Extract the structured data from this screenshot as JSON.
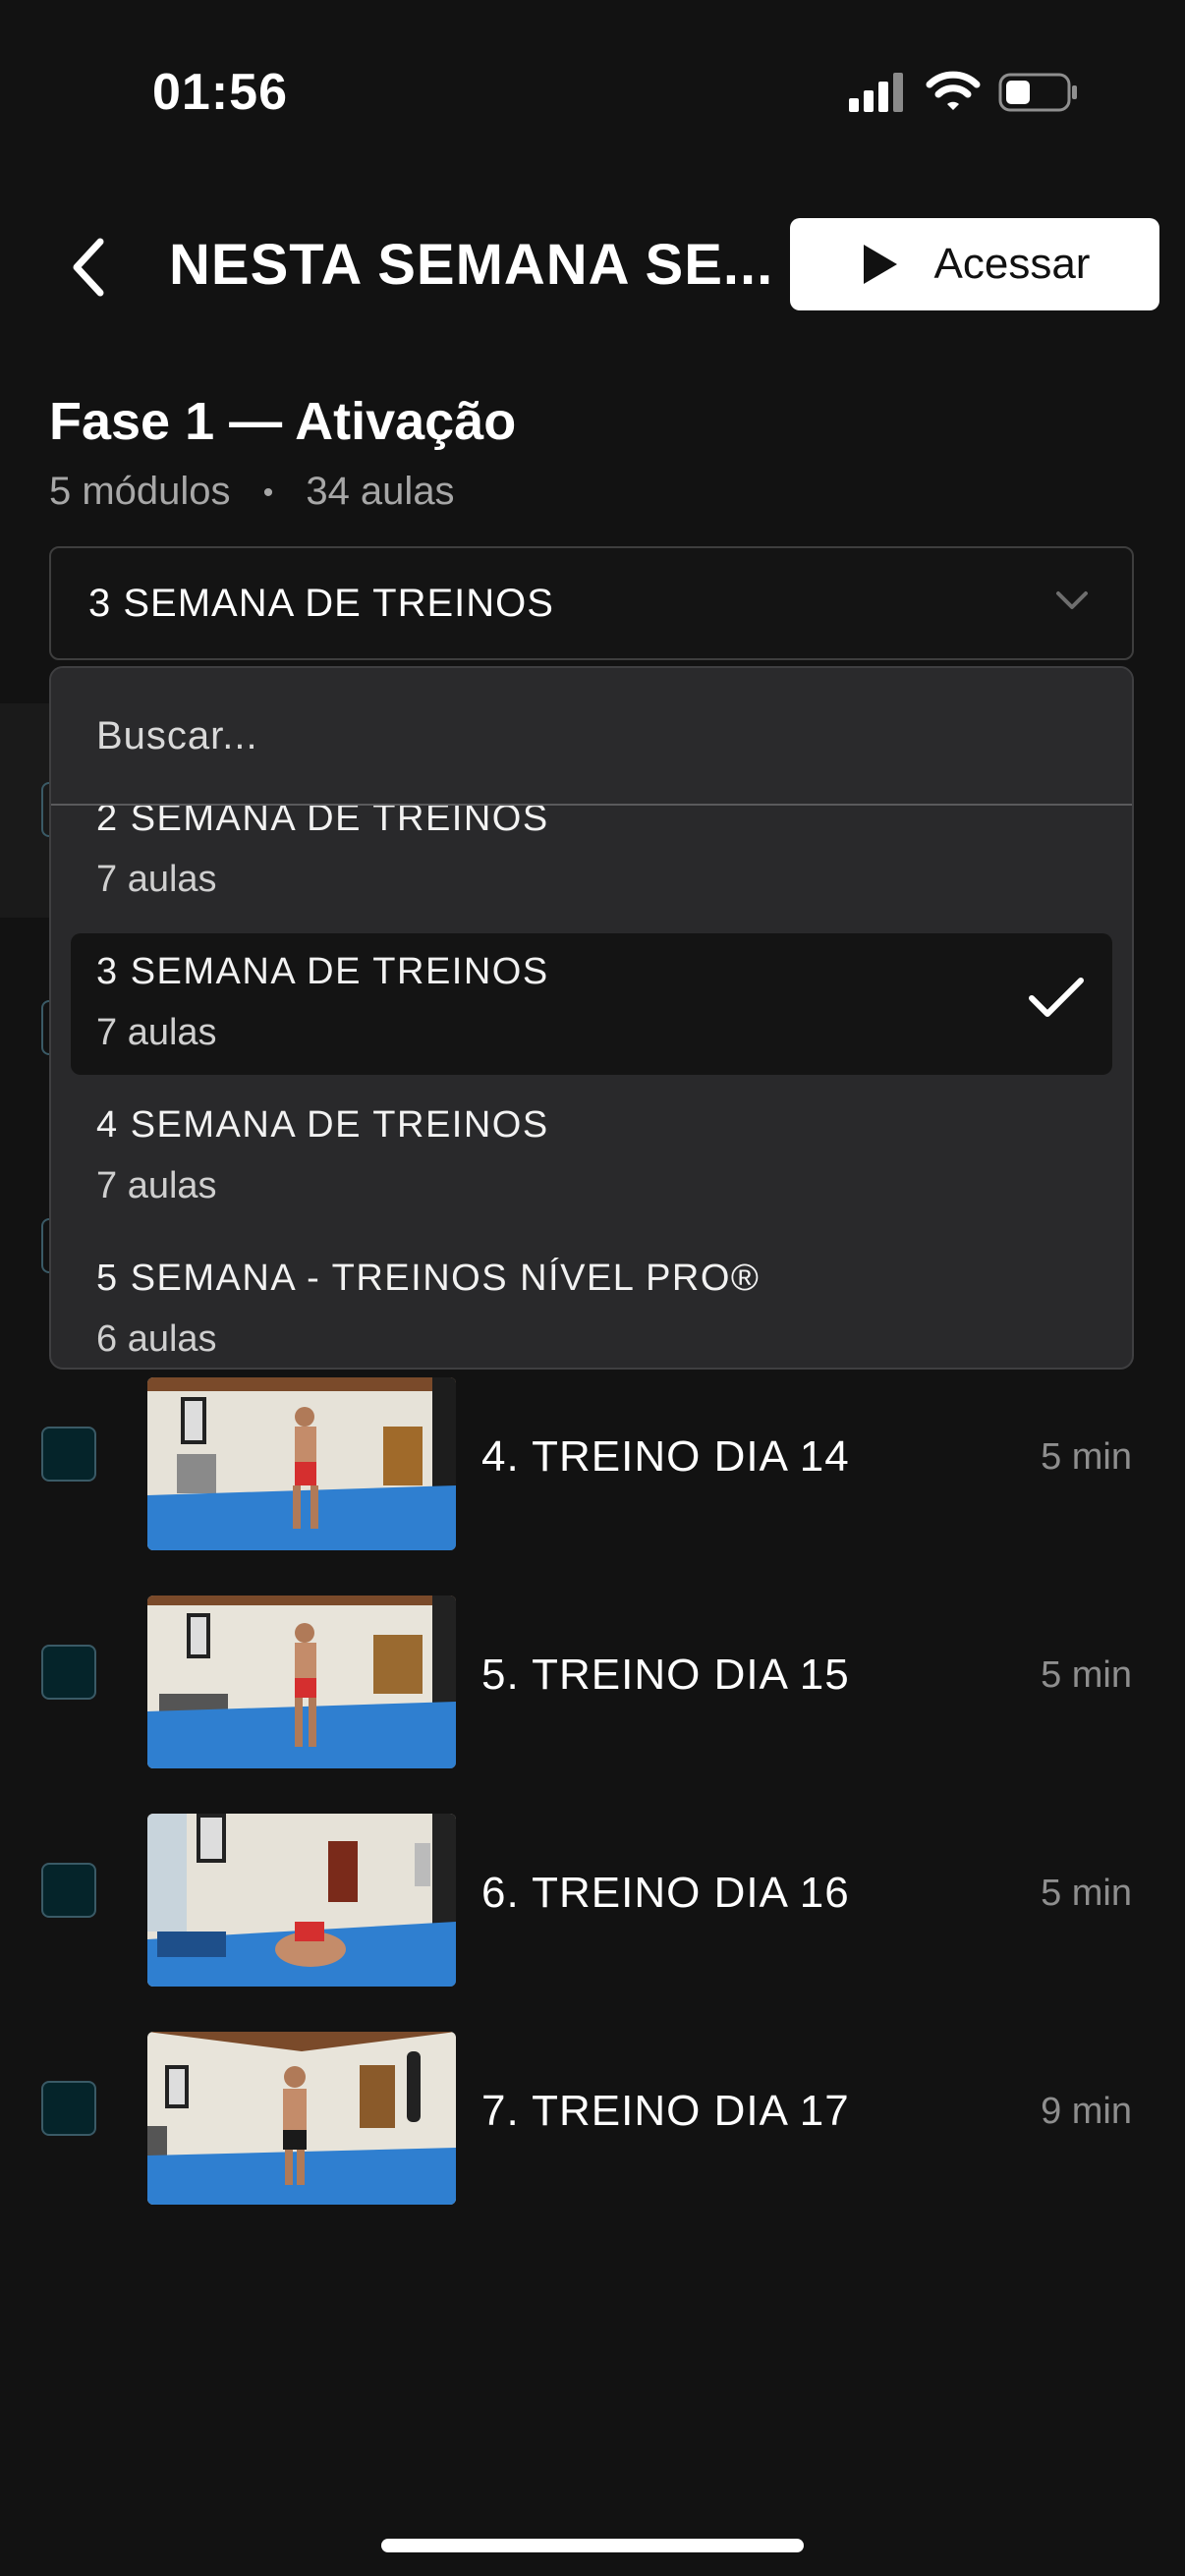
{
  "status_bar": {
    "time": "01:56"
  },
  "header": {
    "title": "NESTA SEMANA SE...",
    "access_label": "Acessar"
  },
  "phase": {
    "title": "Fase 1 — Ativação",
    "modules": "5 módulos",
    "separator": "•",
    "lessons": "34 aulas"
  },
  "week_select": {
    "value": "3 SEMANA DE TREINOS"
  },
  "dropdown": {
    "search_placeholder": "Buscar...",
    "options": [
      {
        "name": "2 SEMANA DE TREINOS",
        "count": "7 aulas",
        "selected": false
      },
      {
        "name": "3 SEMANA DE TREINOS",
        "count": "7 aulas",
        "selected": true
      },
      {
        "name": "4 SEMANA DE TREINOS",
        "count": "7 aulas",
        "selected": false
      },
      {
        "name": "5 SEMANA - TREINOS NÍVEL PRO®",
        "count": "6 aulas",
        "selected": false
      }
    ]
  },
  "lessons": [
    {
      "title": "4. TREINO DIA 14",
      "duration": "5 min"
    },
    {
      "title": "5. TREINO DIA 15",
      "duration": "5 min"
    },
    {
      "title": "6. TREINO DIA 16",
      "duration": "5 min"
    },
    {
      "title": "7. TREINO DIA 17",
      "duration": "9 min"
    }
  ],
  "icons": {
    "back": "chevron-left-icon",
    "play": "play-icon",
    "dropdown": "chevron-down-icon",
    "selected": "checkmark-icon"
  },
  "colors": {
    "background": "#121212",
    "checkbox_fill": "#05242a",
    "floor_blue": "#2f7fd0"
  }
}
